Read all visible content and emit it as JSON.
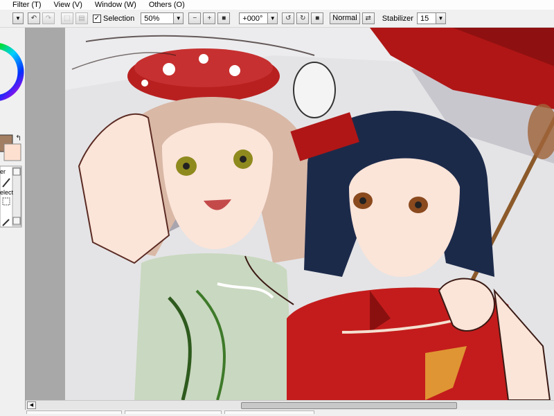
{
  "menu": {
    "items": [
      "Filter (T)",
      "View (V)",
      "Window (W)",
      "Others (O)"
    ]
  },
  "toolbar": {
    "selection_label": "Selection",
    "selection_checked": true,
    "zoom_value": "50%",
    "rotation_value": "+000°",
    "blend_mode_label": "Normal",
    "stabilizer_label": "Stabilizer",
    "stabilizer_value": "15"
  },
  "left_panel": {
    "primary_color": "#a27e62",
    "secondary_color": "#fde0d0",
    "tool_labels": [
      "er",
      "elect"
    ]
  },
  "colors": {
    "accent_red": "#b01616",
    "hair_navy": "#1c2a4a",
    "dress_green": "#c9d8c0",
    "skin": "#fbe4d8"
  }
}
